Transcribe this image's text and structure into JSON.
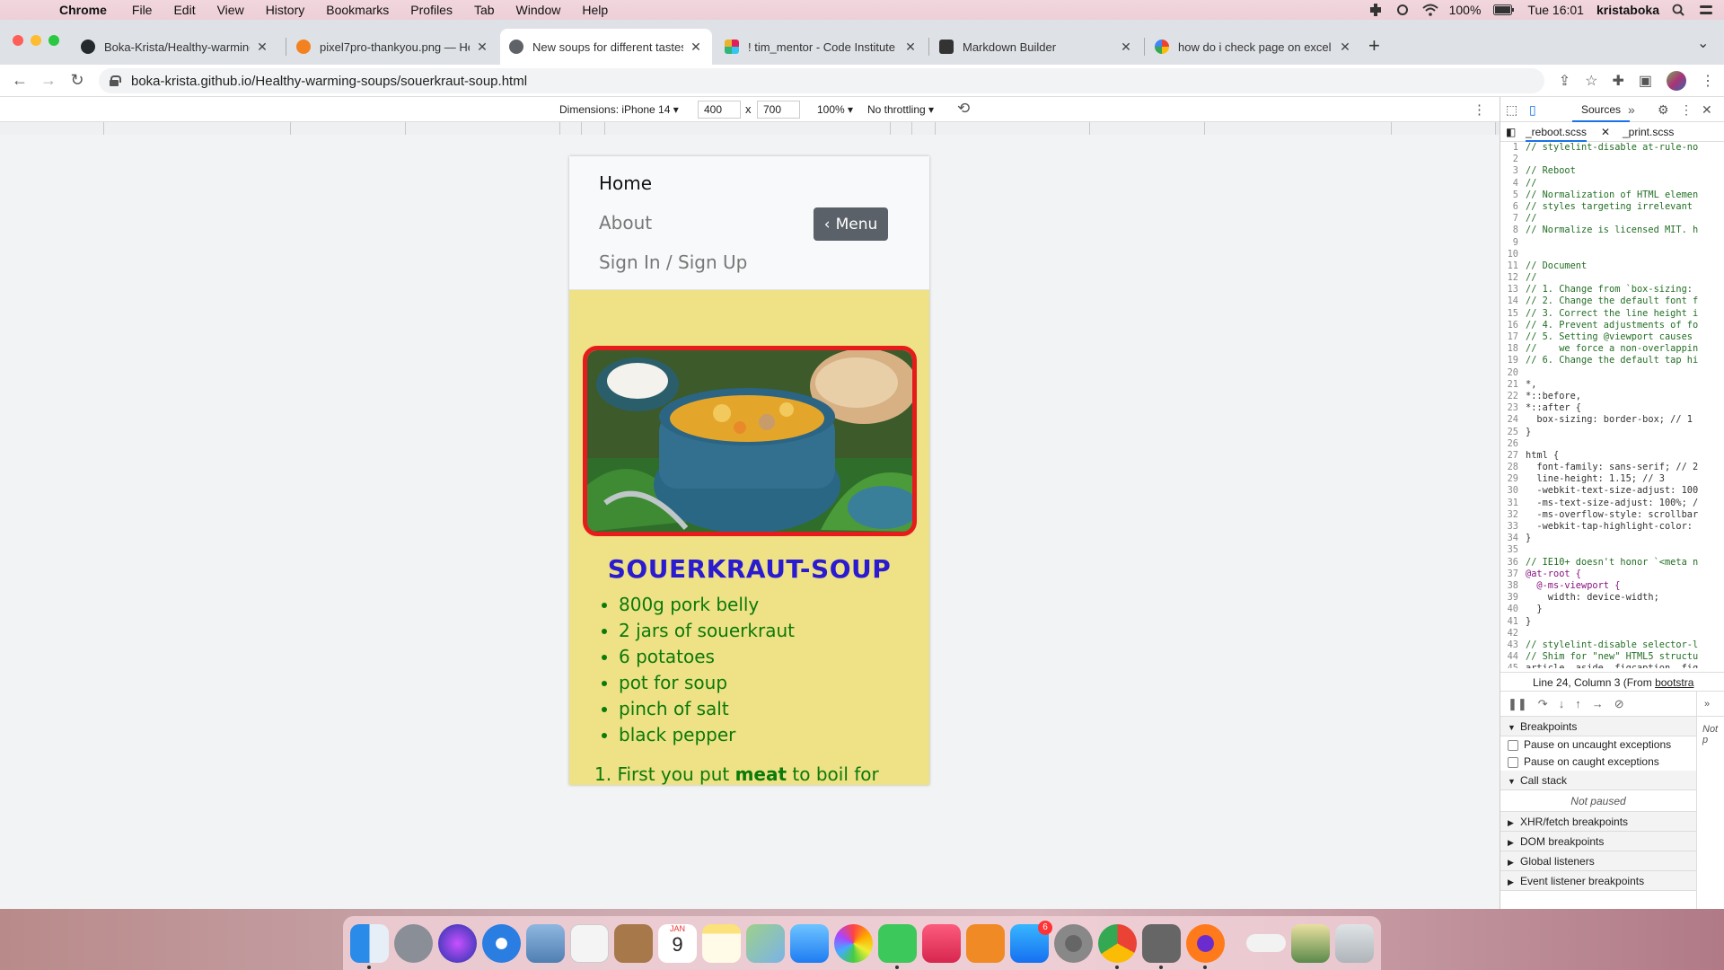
{
  "menubar": {
    "app": "Chrome",
    "items": [
      "File",
      "Edit",
      "View",
      "History",
      "Bookmarks",
      "Profiles",
      "Tab",
      "Window",
      "Help"
    ],
    "battery": "100%",
    "clock": "Tue 16:01",
    "user": "kristaboka"
  },
  "tabs": [
    {
      "title": "Boka-Krista/Healthy-warming-",
      "color": "#24292e"
    },
    {
      "title": "pixel7pro-thankyou.png — Hea",
      "color": "#f48120"
    },
    {
      "title": "New soups for different tastes",
      "color": "#5f6368"
    },
    {
      "title": "! tim_mentor - Code Institute -",
      "color": "#4a154b"
    },
    {
      "title": "Markdown Builder",
      "color": "#333333"
    },
    {
      "title": "how do i check page on excel s",
      "color": "#4285f4"
    }
  ],
  "omnibox": {
    "url": "boka-krista.github.io/Healthy-warming-soups/souerkraut-soup.html"
  },
  "device_toolbar": {
    "dimensions_label": "Dimensions: iPhone 14 ▾",
    "width": "400",
    "times": "x",
    "height": "700",
    "zoom": "100% ▾",
    "throttling": "No throttling ▾"
  },
  "site": {
    "nav": {
      "home": "Home",
      "about": "About",
      "signin": "Sign In / Sign Up",
      "menu_button": "Menu",
      "menu_caret": "‹"
    },
    "title": "SOUERKRAUT-SOUP",
    "ingredients": [
      "800g pork belly",
      "2 jars of souerkraut",
      "6 potatoes",
      "pot for soup",
      "pinch of salt",
      "black pepper"
    ],
    "step1": {
      "num": "1.",
      "before": "First you put",
      "bold": "meat",
      "after": "to boil for"
    },
    "colors": {
      "background": "#efe185",
      "title": "#2a1bd0",
      "ingredients": "#0a7a0a",
      "image_border": "#e61c1c"
    }
  },
  "devtools": {
    "panel": "Sources",
    "files": [
      "_reboot.scss",
      "_print.scss"
    ],
    "code": [
      "// stylelint-disable at-rule-no",
      "",
      "// Reboot",
      "//",
      "// Normalization of HTML elemen",
      "// styles targeting irrelevant",
      "//",
      "// Normalize is licensed MIT. h",
      "",
      "",
      "// Document",
      "//",
      "// 1. Change from `box-sizing:",
      "// 2. Change the default font f",
      "// 3. Correct the line height i",
      "// 4. Prevent adjustments of fo",
      "// 5. Setting @viewport causes",
      "//    we force a non-overlappin",
      "// 6. Change the default tap hi",
      "",
      "*,",
      "*::before,",
      "*::after {",
      "  box-sizing: border-box; // 1",
      "}",
      "",
      "html {",
      "  font-family: sans-serif; // 2",
      "  line-height: 1.15; // 3",
      "  -webkit-text-size-adjust: 100",
      "  -ms-text-size-adjust: 100%; /",
      "  -ms-overflow-style: scrollbar",
      "  -webkit-tap-highlight-color:",
      "}",
      "",
      "// IE10+ doesn't honor `<meta n",
      "@at-root {",
      "  @-ms-viewport {",
      "    width: device-width;",
      "  }",
      "}",
      "",
      "// stylelint-disable selector-l",
      "// Shim for \"new\" HTML5 structu",
      "article, aside, figcaption, fig"
    ],
    "status_prefix": "Line 24, Column 3  (From",
    "status_link": "bootstra",
    "sections": {
      "breakpoints": "Breakpoints",
      "pause_uncaught": "Pause on uncaught exceptions",
      "pause_caught": "Pause on caught exceptions",
      "call_stack": "Call stack",
      "not_paused": "Not paused",
      "xhr": "XHR/fetch breakpoints",
      "dom": "DOM breakpoints",
      "global": "Global listeners",
      "event": "Event listener breakpoints"
    },
    "side_not_paused": "Not p"
  },
  "dock": {
    "calendar_month": "JAN",
    "calendar_day": "9",
    "appstore_badge": "6"
  }
}
